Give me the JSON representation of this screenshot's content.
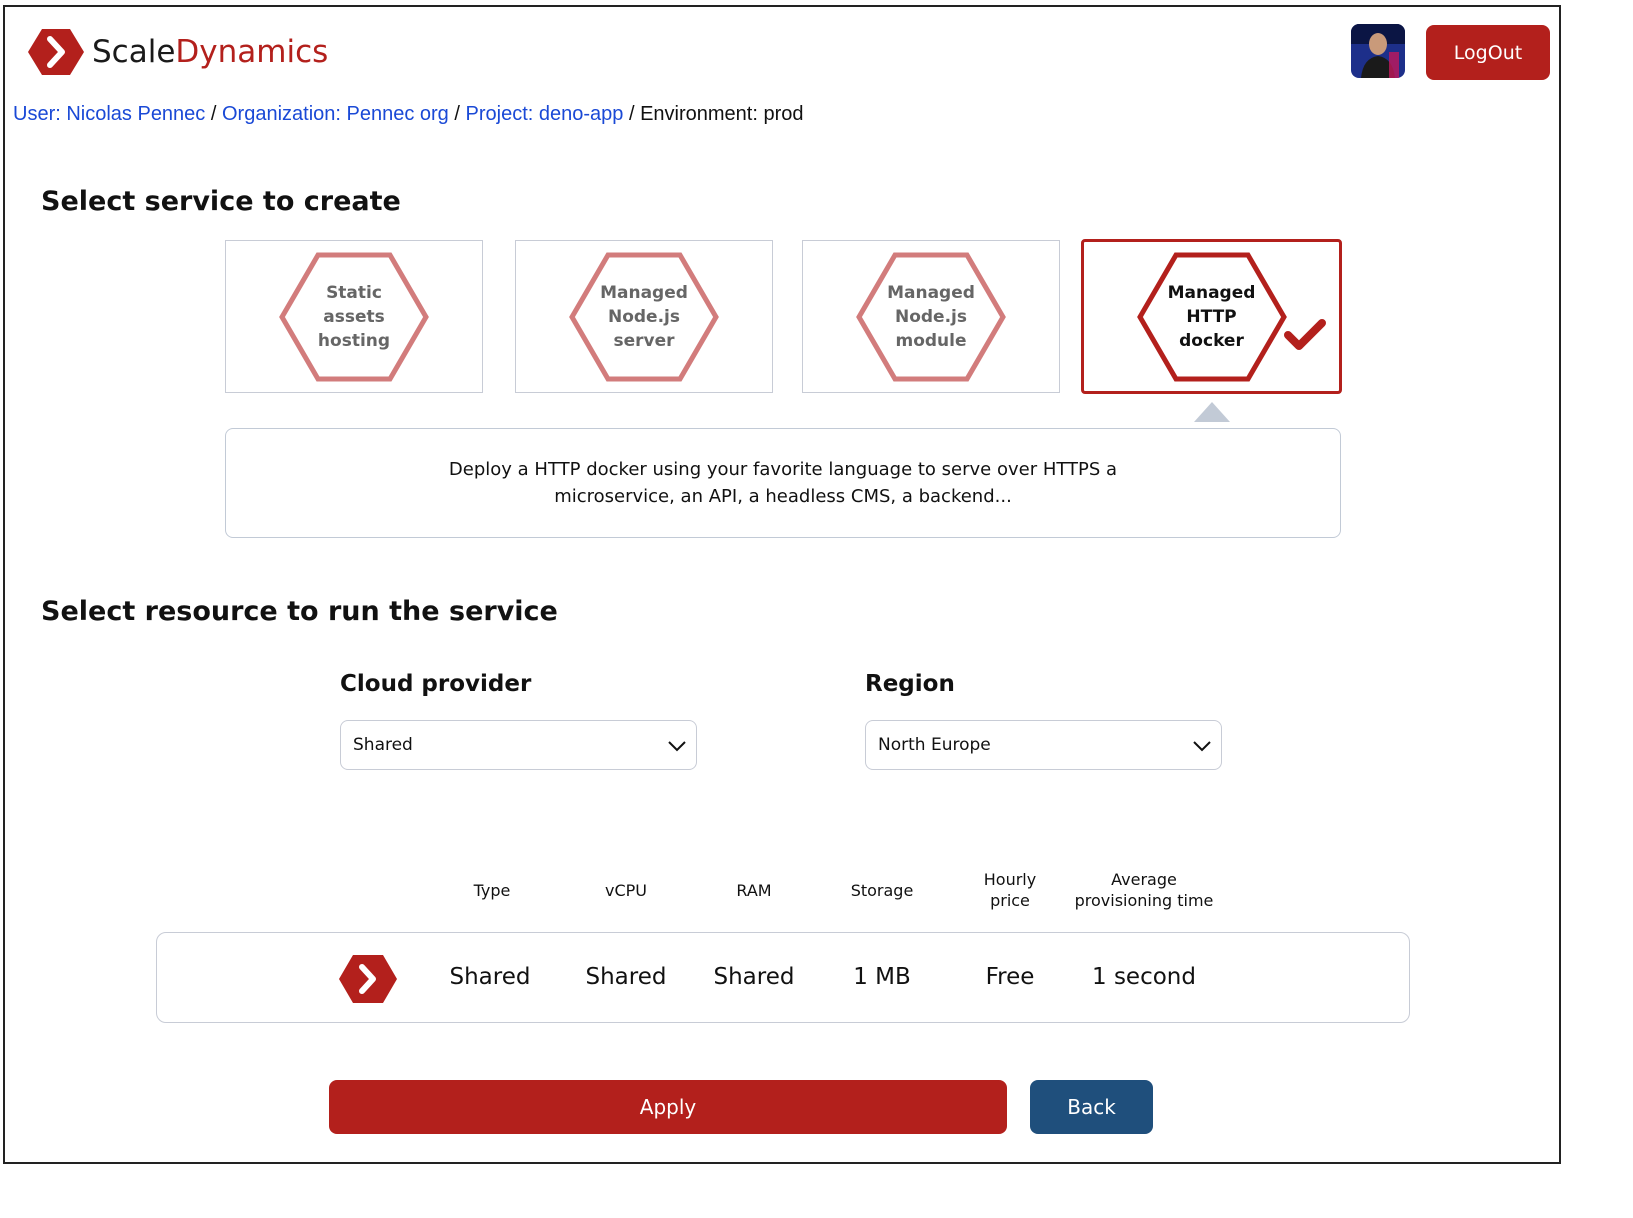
{
  "brand": {
    "name_part1": "Scale",
    "name_part2": "Dynamics",
    "accent": "#b3201c"
  },
  "header": {
    "logout_label": "LogOut",
    "avatar": "user-avatar"
  },
  "breadcrumb": {
    "user": "User: Nicolas Pennec",
    "organization": "Organization: Pennec org",
    "project": "Project: deno-app",
    "environment": "Environment: prod",
    "separator": "/"
  },
  "service_section": {
    "title": "Select service to create",
    "cards": [
      {
        "line1": "Static",
        "line2": "assets",
        "line3": "hosting",
        "selected": false
      },
      {
        "line1": "Managed",
        "line2": "Node.js",
        "line3": "server",
        "selected": false
      },
      {
        "line1": "Managed",
        "line2": "Node.js",
        "line3": "module",
        "selected": false
      },
      {
        "line1": "Managed",
        "line2": "HTTP",
        "line3": "docker",
        "selected": true
      }
    ],
    "description": "Deploy a HTTP docker using your favorite language to serve over HTTPS a microservice, an API, a headless CMS, a backend..."
  },
  "resource_section": {
    "title": "Select resource to run the service",
    "cloud_provider": {
      "label": "Cloud provider",
      "value": "Shared"
    },
    "region": {
      "label": "Region",
      "value": "North Europe"
    },
    "table": {
      "headers": {
        "type": "Type",
        "vcpu": "vCPU",
        "ram": "RAM",
        "storage": "Storage",
        "hourly_l1": "Hourly",
        "hourly_l2": "price",
        "prov_l1": "Average",
        "prov_l2": "provisioning time"
      },
      "row": {
        "type": "Shared",
        "vcpu": "Shared",
        "ram": "Shared",
        "storage": "1 MB",
        "price": "Free",
        "provisioning": "1 second"
      }
    }
  },
  "actions": {
    "apply_label": "Apply",
    "back_label": "Back"
  },
  "colors": {
    "primary": "#b3201c",
    "secondary": "#1f4f7c",
    "link": "#1a49d6",
    "hexagon_faded": "#d27c7c"
  }
}
